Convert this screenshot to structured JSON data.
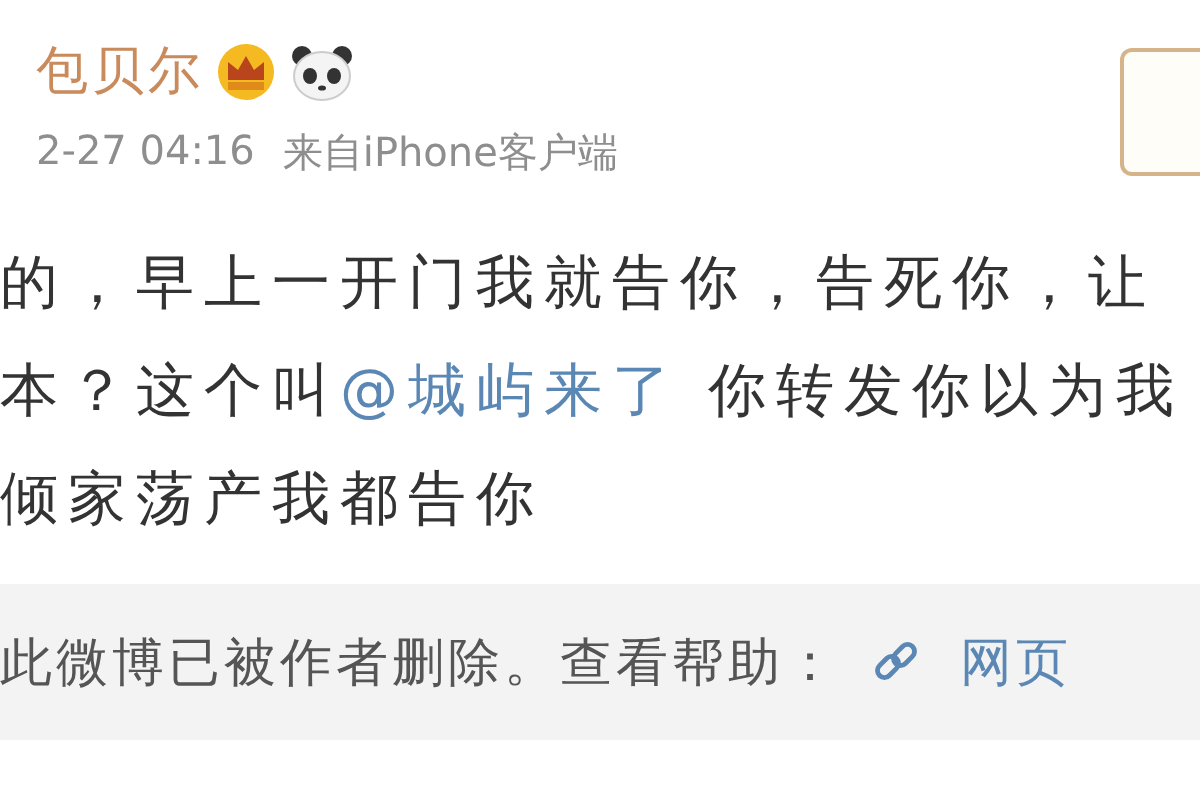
{
  "post": {
    "author": "包贝尔",
    "time": "2-27 04:16",
    "source": "来自iPhone客户端",
    "lines": [
      [
        {
          "kind": "text",
          "text": "的，早上一开门我就告你，告死你，让"
        }
      ],
      [
        {
          "kind": "text",
          "text": "本？这个叫"
        },
        {
          "kind": "mention",
          "text": "@城屿来了"
        },
        {
          "kind": "text",
          "text": " 你转发你以为我"
        }
      ],
      [
        {
          "kind": "text",
          "text": "倾家荡产我都告你"
        }
      ]
    ],
    "notice": {
      "text": "此微博已被作者删除。查看帮助：",
      "link": "网页"
    }
  }
}
